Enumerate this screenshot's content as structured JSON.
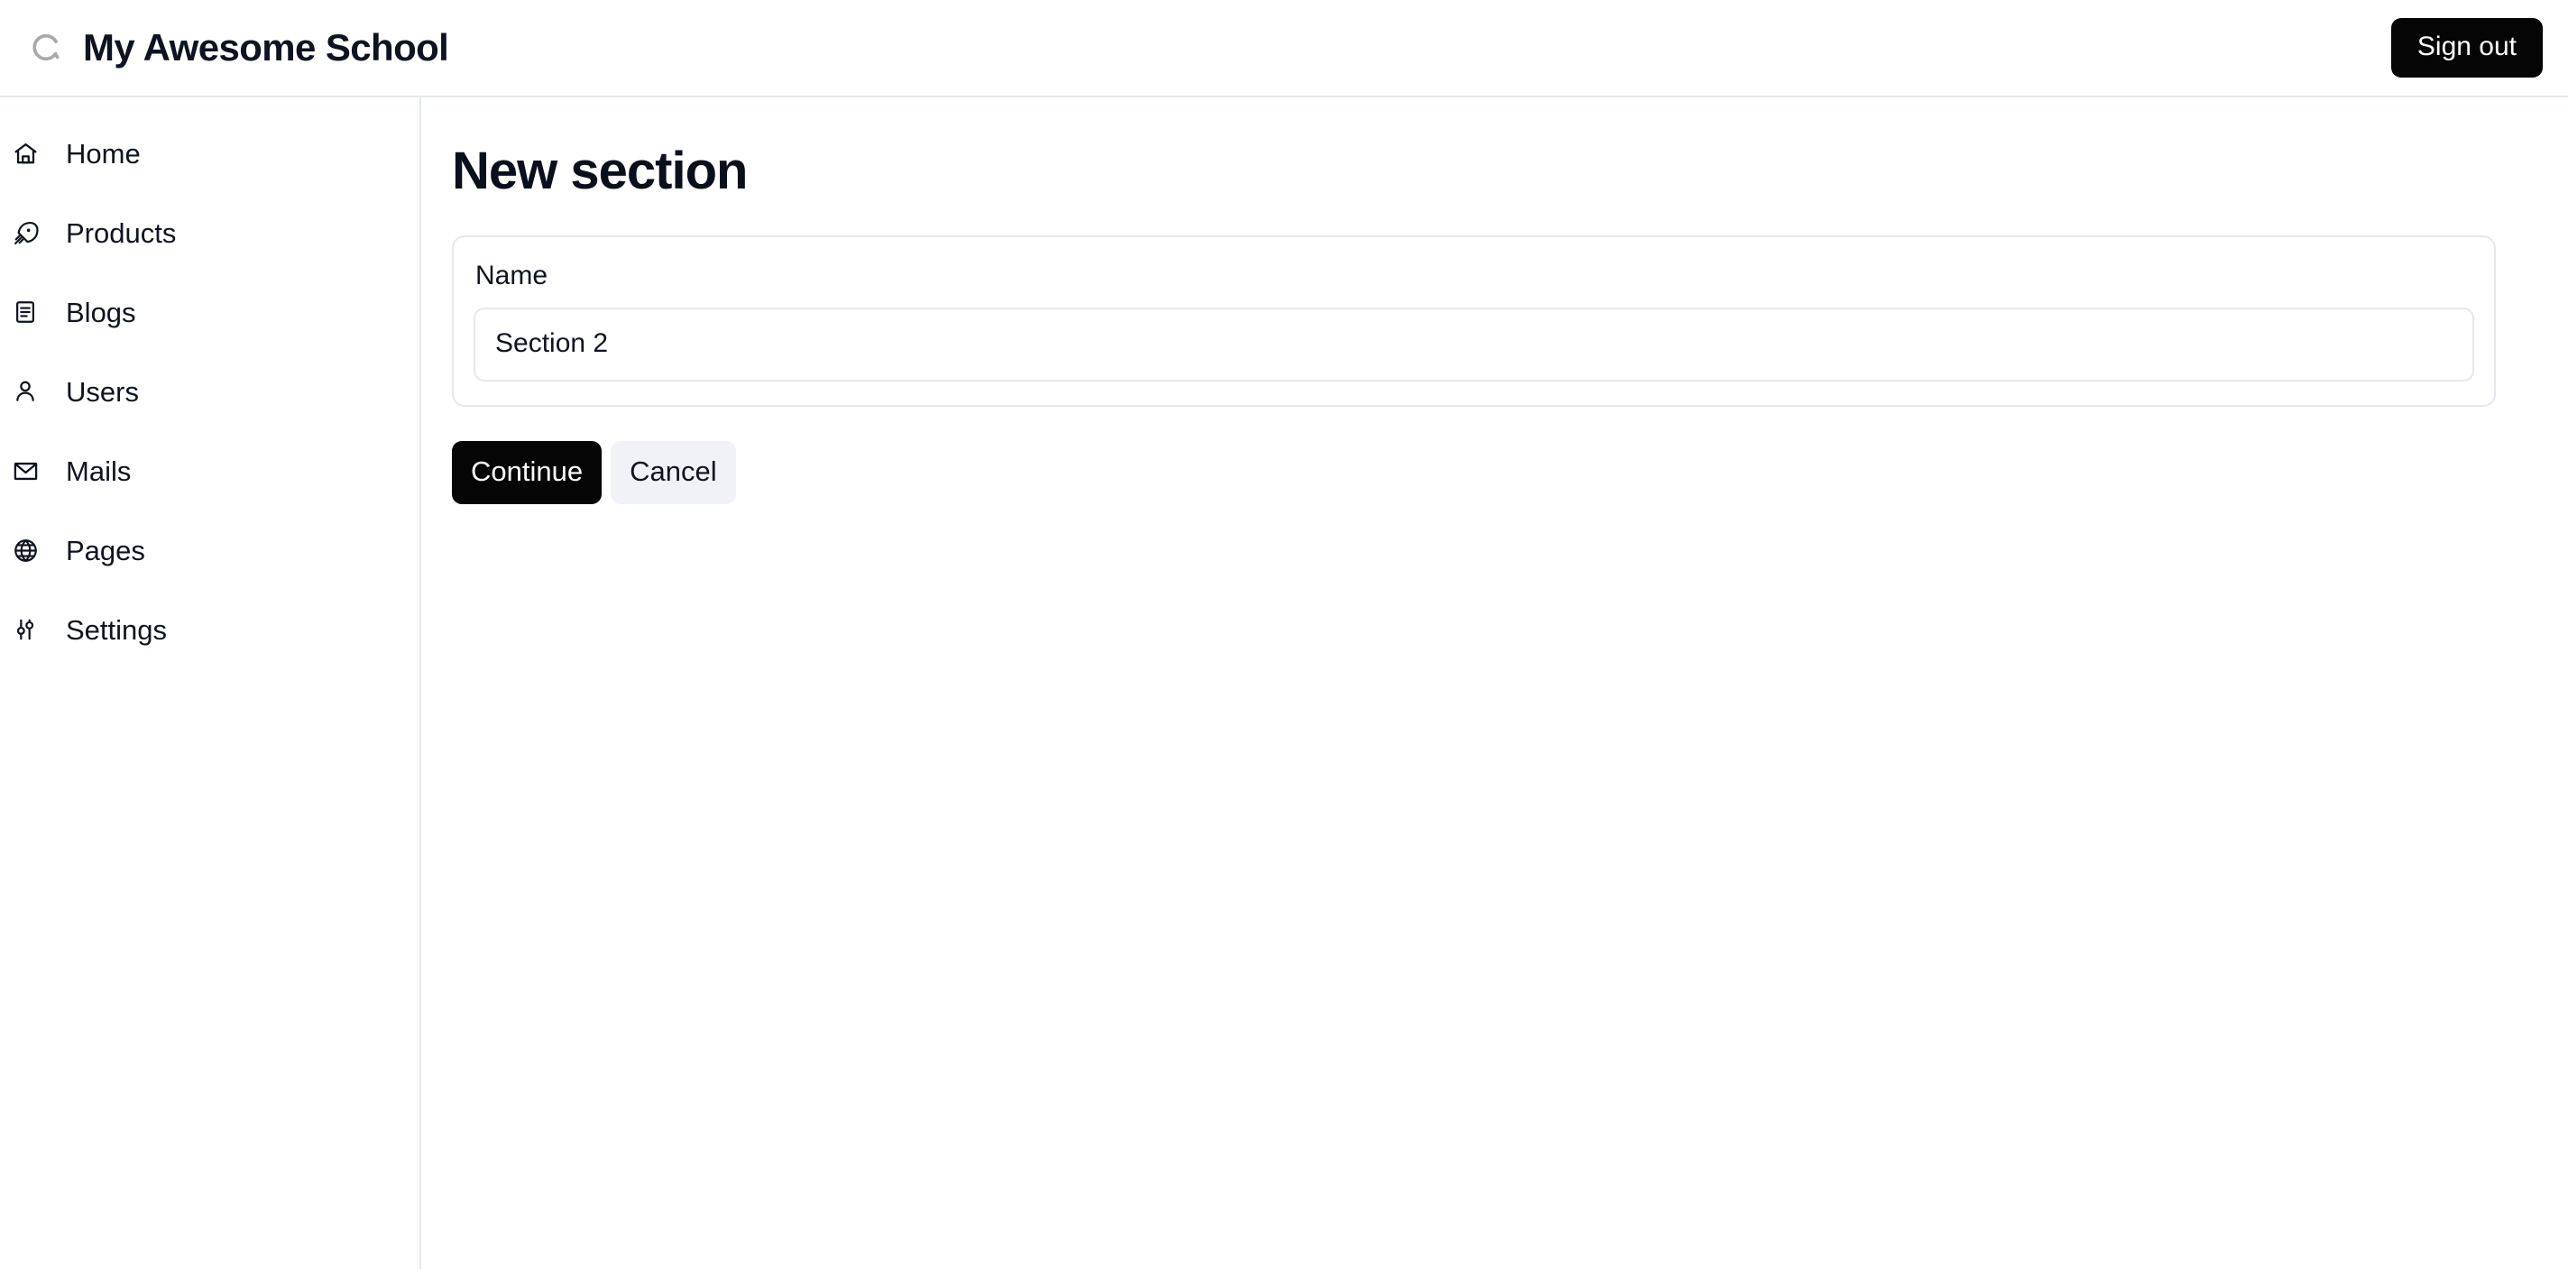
{
  "header": {
    "logo_icon": "partial-circle-c-logo-icon",
    "title": "My Awesome School",
    "signout_label": "Sign out"
  },
  "sidebar": {
    "items": [
      {
        "label": "Home",
        "icon": "home-icon"
      },
      {
        "label": "Products",
        "icon": "rocket-icon"
      },
      {
        "label": "Blogs",
        "icon": "file-text-icon"
      },
      {
        "label": "Users",
        "icon": "user-icon"
      },
      {
        "label": "Mails",
        "icon": "envelope-icon"
      },
      {
        "label": "Pages",
        "icon": "globe-icon"
      },
      {
        "label": "Settings",
        "icon": "sliders-icon"
      }
    ]
  },
  "main": {
    "page_title": "New section",
    "form": {
      "name_label": "Name",
      "name_value": "Section 2",
      "name_placeholder": "Name"
    },
    "actions": {
      "continue_label": "Continue",
      "cancel_label": "Cancel"
    }
  },
  "colors": {
    "text": "#0d1320",
    "border": "#e4e8ee",
    "primary_button_bg": "#050505",
    "primary_button_text": "#ffffff",
    "secondary_button_bg": "#f0f2f7",
    "logo": "#a9a9a9",
    "page_bg": "#ffffff"
  }
}
